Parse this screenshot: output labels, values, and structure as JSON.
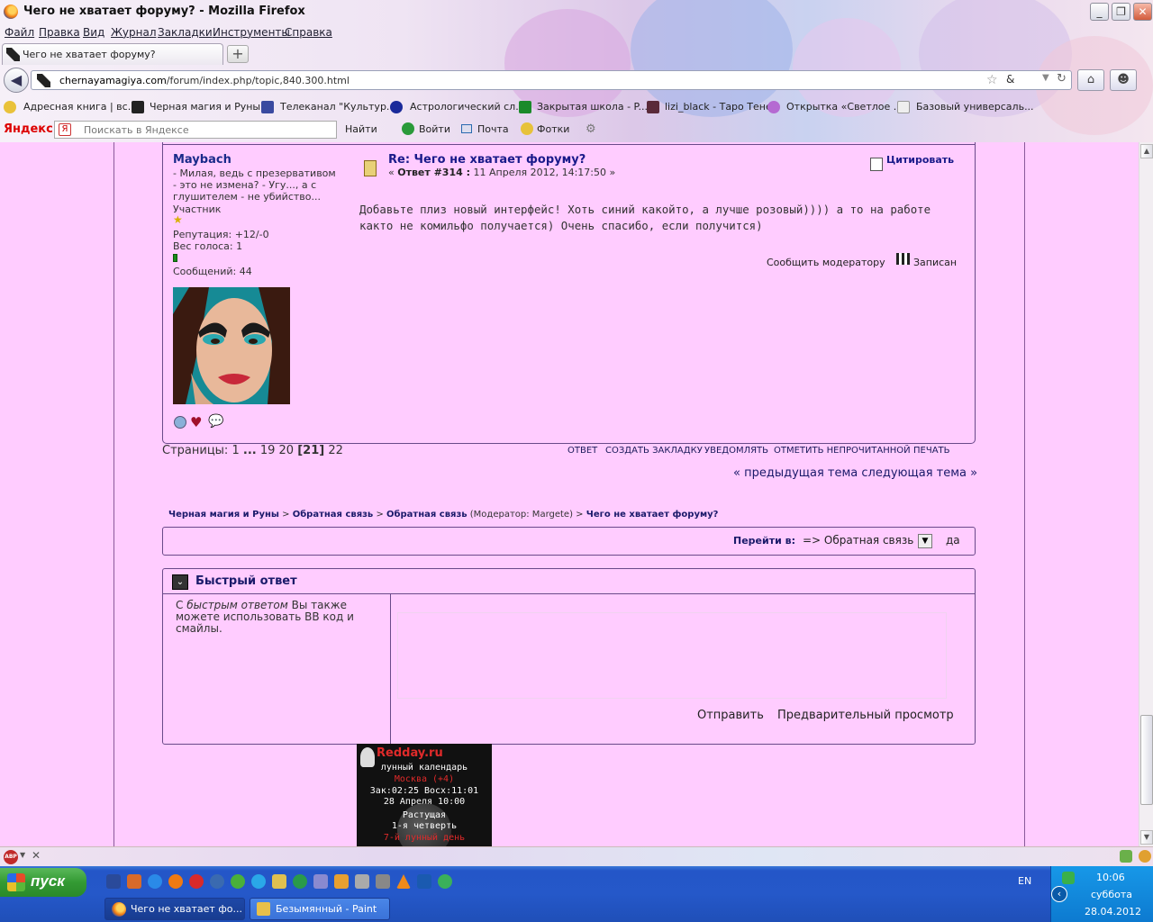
{
  "window": {
    "title": "Чего не хватает форуму? - Mozilla Firefox"
  },
  "menu": [
    "Файл",
    "Правка",
    "Вид",
    "Журнал",
    "Закладки",
    "Инструменты",
    "Справка"
  ],
  "tab": {
    "title": "Чего не хватает форуму?",
    "new_tab": "+"
  },
  "address": {
    "host": "chernayamagiya.com",
    "path": "/forum/index.php/topic,840.300.html"
  },
  "bookmarks": [
    "Адресная книга | вс...",
    "Черная магия и Руны",
    "Телеканал \"Культур...",
    "Астрологический сл...",
    "Закрытая школа - P...",
    "lizi_black - Таро Теней",
    "Открытка «Светлое ...",
    "Базовый универсаль..."
  ],
  "yandex": {
    "logo": "Яндекс",
    "search_placeholder": "Поискать в Яндексе",
    "find": "Найти",
    "login": "Войти",
    "mail": "Почта",
    "photos": "Фотки"
  },
  "post": {
    "author": "Maybach",
    "signature": [
      "- Милая, ведь с презервативом",
      "- это не измена? - Угу..., а с",
      "глушителем - не убийство..."
    ],
    "rank": "Участник",
    "reputation": "Репутация: +12/-0",
    "vote_weight": "Вес голоса: 1",
    "messages": "Сообщений: 44",
    "subject": "Re: Чего не хватает форуму?",
    "meta_prefix": "«",
    "meta_reply": "Ответ #314 :",
    "meta_date": "11 Апреля 2012, 14:17:50 »",
    "body": "Добавьте плиз новый интерфейс! Хоть синий какойто, а лучше розовый)))) а то на работе както не комильфо получается) Очень спасибо, если получится)",
    "quote": "Цитировать",
    "report": "Сообщить модератору",
    "logged": "Записан"
  },
  "pagination": {
    "label": "Страницы:",
    "first": "1",
    "dots": "...",
    "p19": "19",
    "p20": "20",
    "current": "[21]",
    "p22": "22"
  },
  "actions": [
    "ОТВЕТ",
    "СОЗДАТЬ ЗАКЛАДКУ",
    "УВЕДОМЛЯТЬ",
    "ОТМЕТИТЬ НЕПРОЧИТАННОЙ",
    "ПЕЧАТЬ"
  ],
  "prevnext": "« предыдущая тема следующая тема »",
  "breadcrumb": {
    "items": [
      "Черная магия и Руны",
      "Обратная связь",
      "Обратная связь",
      "Чего не хватает форуму?"
    ],
    "moderator": "(Модератор: Margete)",
    "sep": ">"
  },
  "jump": {
    "label": "Перейти в:",
    "selected": "=> Обратная связь",
    "go": "да"
  },
  "quick_reply": {
    "title": "Быстрый ответ",
    "hint_pre": "С",
    "hint_em": "быстрым ответом",
    "hint_post": "Вы также можете использовать BB код и смайлы.",
    "send": "Отправить",
    "preview": "Предварительный просмотр"
  },
  "moon_widget": {
    "brand": "Redday.ru",
    "line1": "лунный календарь",
    "city": "Москва (+4)",
    "rise": "Зак:02:25 Восх:11:01",
    "date": "28 Апреля 10:00",
    "phase": "Растущая",
    "quarter": "1-я четверть",
    "day": "7-й лунный день"
  },
  "taskbar": {
    "start": "пуск",
    "windows": [
      "Чего не хватает фо...",
      "Безымянный - Paint"
    ],
    "lang": "EN",
    "time": "10:06",
    "weekday": "суббота",
    "date": "28.04.2012"
  },
  "colors": {
    "page_bg": "#ffccff",
    "link": "#1a1a8a",
    "border": "#6a4a8a",
    "taskbar": "#2456c8"
  }
}
